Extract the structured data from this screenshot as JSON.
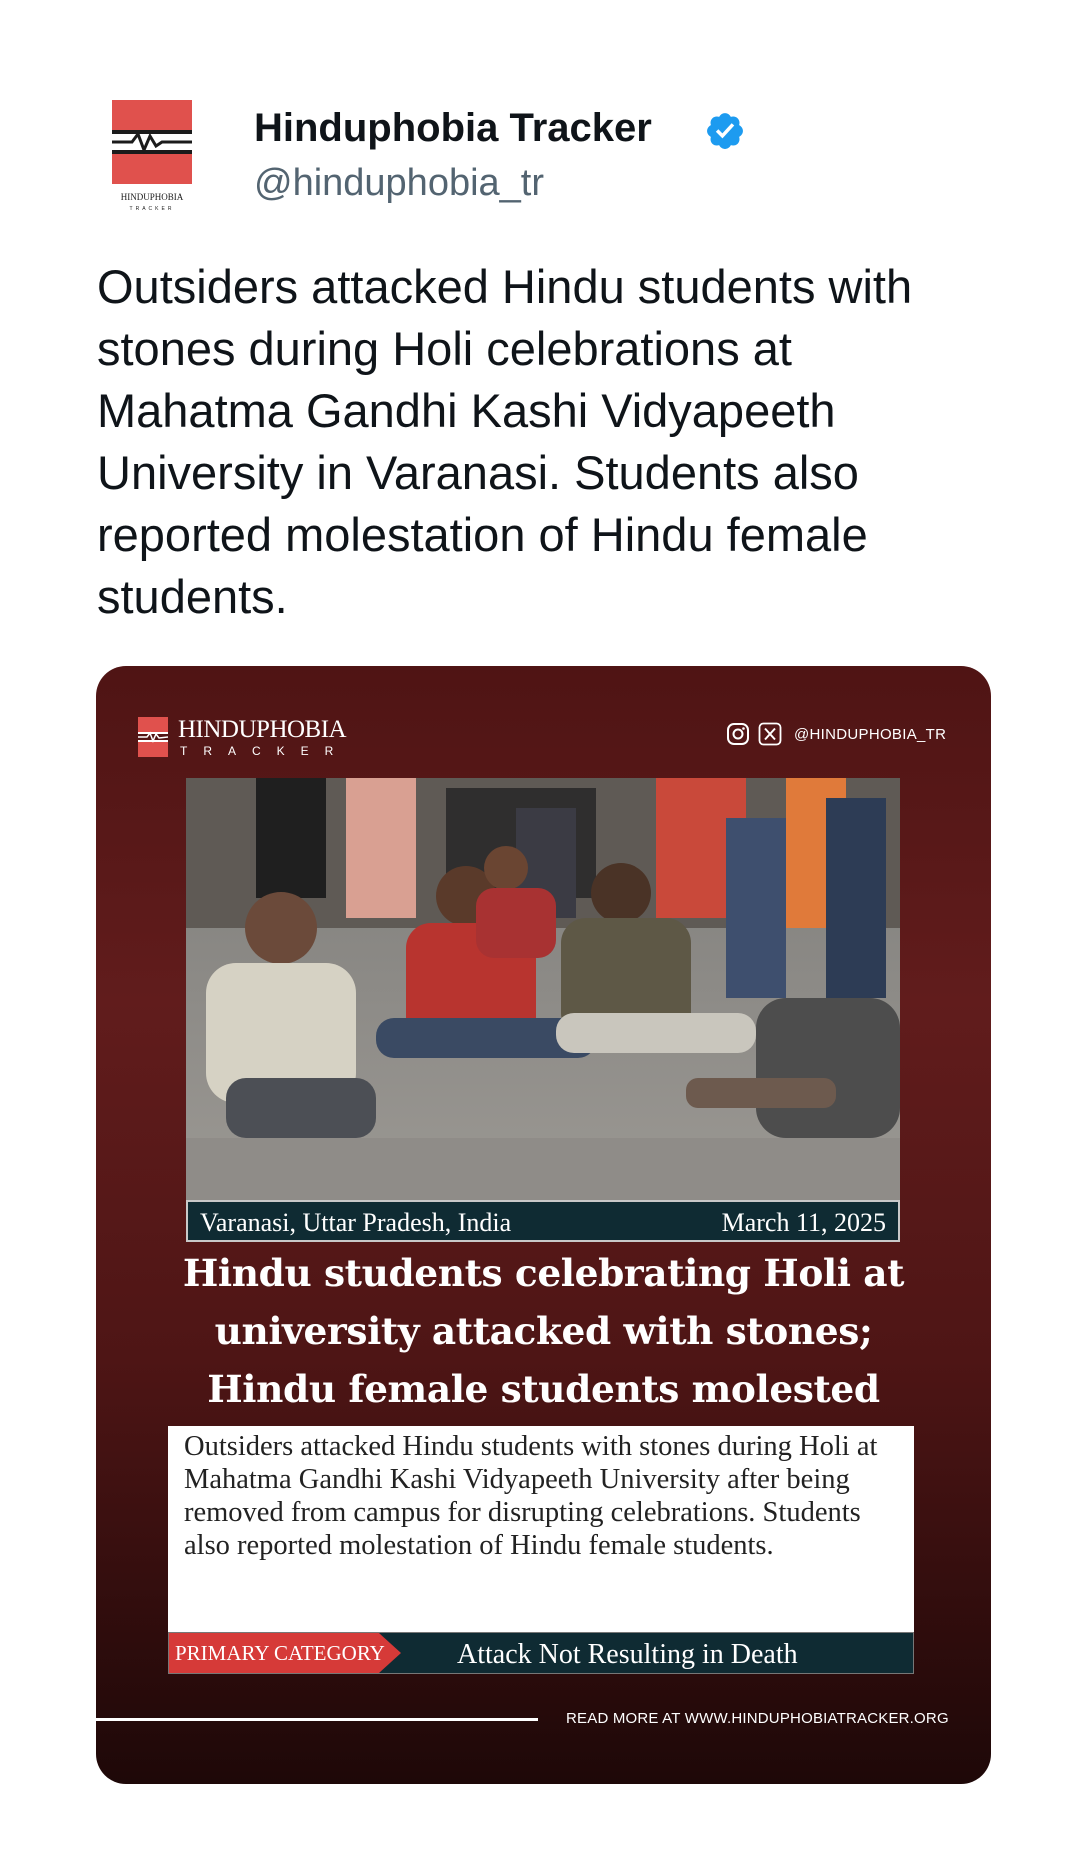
{
  "author": {
    "name": "Hinduphobia Tracker",
    "handle": "@hinduphobia_tr",
    "avatar_text": "HINDUPHOBIA",
    "avatar_subtext": "TRACKER"
  },
  "tweet": {
    "text": "Outsiders attacked Hindu students with stones during Holi celebrations at Mahatma Gandhi Kashi Vidyapeeth University in Varanasi. Students also reported molestation of Hindu female students."
  },
  "card": {
    "brand_name": "HINDUPHOBIA",
    "brand_sub": "TRACKER",
    "social_handle": "@HINDUPHOBIA_TR",
    "location": "Varanasi, Uttar Pradesh, India",
    "date": "March 11, 2025",
    "headline": [
      "Hindu students celebrating Holi at",
      "university attacked with stones;",
      "Hindu female students molested"
    ],
    "summary": "Outsiders attacked Hindu students with stones during Holi at Mahatma Gandhi Kashi Vidyapeeth University after being removed from campus for disrupting celebrations. Students also reported molestation of Hindu female students.",
    "category_label": "PRIMARY CATEGORY",
    "category_value": "Attack Not Resulting in Death",
    "footer": "READ MORE AT WWW.HINDUPHOBIATRACKER.ORG"
  },
  "colors": {
    "brand_red": "#e0514d",
    "verified_blue": "#1d9bf0",
    "card_bg": "#5a1a1a",
    "bar_teal": "#0f2b33",
    "category_red": "#d63a38"
  },
  "icons": [
    "verified-badge-icon",
    "instagram-icon",
    "x-icon",
    "heartbeat-logo-icon"
  ]
}
